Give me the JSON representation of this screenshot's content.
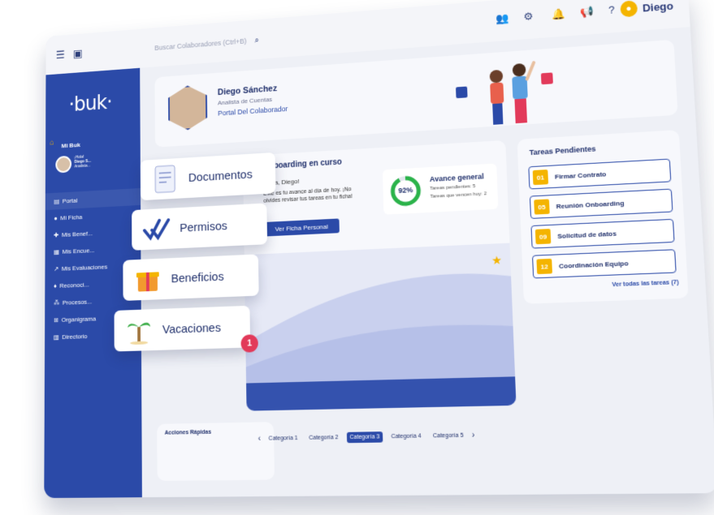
{
  "topbar": {
    "search_placeholder": "Buscar Colaboradores (Ctrl+B)",
    "user_name": "Diego"
  },
  "sidebar": {
    "logo": "·buk·",
    "section": "Mi Buk",
    "user_greeting": "¡Hola!",
    "user_name": "Diego S...",
    "user_role": "Analista...",
    "items": [
      {
        "label": "Portal"
      },
      {
        "label": "Mi Ficha"
      },
      {
        "label": "Mis Benef..."
      },
      {
        "label": "Mis Encue..."
      },
      {
        "label": "Mis Evaluaciones"
      },
      {
        "label": "Reconoci..."
      },
      {
        "label": "Procesos..."
      },
      {
        "label": "Organigrama"
      },
      {
        "label": "Directorio"
      }
    ]
  },
  "profile": {
    "name": "Diego Sánchez",
    "role": "Analista de Cuentas",
    "link": "Portal Del Colaborador"
  },
  "onboarding": {
    "title": "Onboarding en curso",
    "greeting": "¡Hola, Diego!",
    "body": "Este es tu avance al día de hoy. ¡No olvides revisar tus tareas en tu ficha!",
    "button": "Ver Ficha Personal",
    "progress_percent": 92,
    "progress_label": "92%",
    "avance_title": "Avance general",
    "pending_text": "Tareas pendientes: 5",
    "due_today_text": "Tareas que vencen hoy: 2"
  },
  "tasks": {
    "title": "Tareas Pendientes",
    "items": [
      {
        "num": "01",
        "label": "Firmar Contrato"
      },
      {
        "num": "05",
        "label": "Reunión Onboarding"
      },
      {
        "num": "09",
        "label": "Solicitud de datos"
      },
      {
        "num": "12",
        "label": "Coordinación Equipo"
      }
    ],
    "see_all": "Ver todas las tareas (7)"
  },
  "quick_actions": {
    "title": "Acciones Rápidas"
  },
  "categories": {
    "items": [
      "Categoría 1",
      "Categoría 2",
      "Categoría 3",
      "Categoría 4",
      "Categoría 5"
    ],
    "active_index": 2
  },
  "floating_cards": [
    {
      "label": "Documentos",
      "icon": "document-icon"
    },
    {
      "label": "Permisos",
      "icon": "checkmark-icon"
    },
    {
      "label": "Beneficios",
      "icon": "gift-icon"
    },
    {
      "label": "Vacaciones",
      "icon": "palm-tree-icon"
    }
  ],
  "vacation_badge": "1",
  "colors": {
    "primary": "#2b4aa8",
    "accent": "#f4b400",
    "badge": "#e23a5a",
    "progress": "#2bb34a"
  }
}
